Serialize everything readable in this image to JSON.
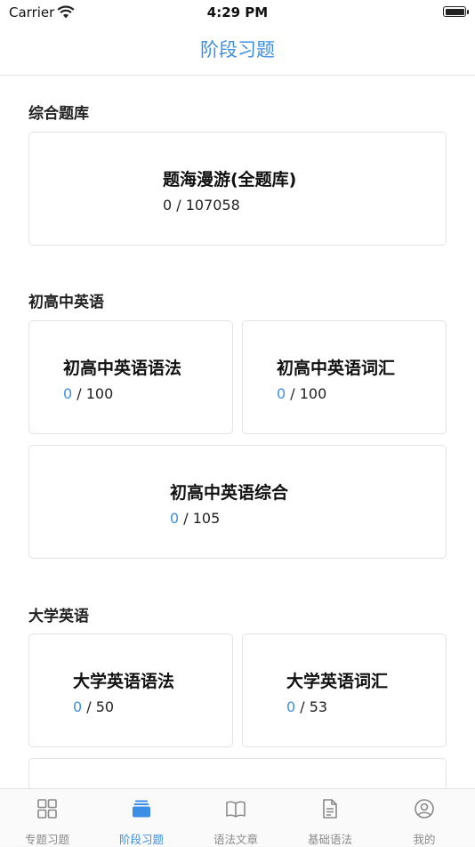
{
  "status_bar": {
    "carrier": "Carrier",
    "time": "4:29 PM"
  },
  "nav": {
    "title": "阶段习题"
  },
  "sections": [
    {
      "title": "综合题库",
      "cards": [
        {
          "title": "题海漫游(全题库)",
          "done": "",
          "total": "0 / 107058"
        }
      ]
    },
    {
      "title": "初高中英语",
      "cards": [
        {
          "title": "初高中英语语法",
          "done": "0",
          "total": " / 100"
        },
        {
          "title": "初高中英语词汇",
          "done": "0",
          "total": " / 100"
        },
        {
          "title": "初高中英语综合",
          "done": "0",
          "total": " / 105"
        }
      ]
    },
    {
      "title": "大学英语",
      "cards": [
        {
          "title": "大学英语语法",
          "done": "0",
          "total": " / 50"
        },
        {
          "title": "大学英语词汇",
          "done": "0",
          "total": " / 53"
        }
      ]
    }
  ],
  "tabs": [
    {
      "label": "专题习题",
      "icon": "grid-icon"
    },
    {
      "label": "阶段习题",
      "icon": "stack-icon",
      "active": true
    },
    {
      "label": "语法文章",
      "icon": "book-icon"
    },
    {
      "label": "基础语法",
      "icon": "document-icon"
    },
    {
      "label": "我的",
      "icon": "user-icon"
    }
  ],
  "colors": {
    "accent": "#3d8fe6",
    "inactive": "#8a8a8a"
  }
}
